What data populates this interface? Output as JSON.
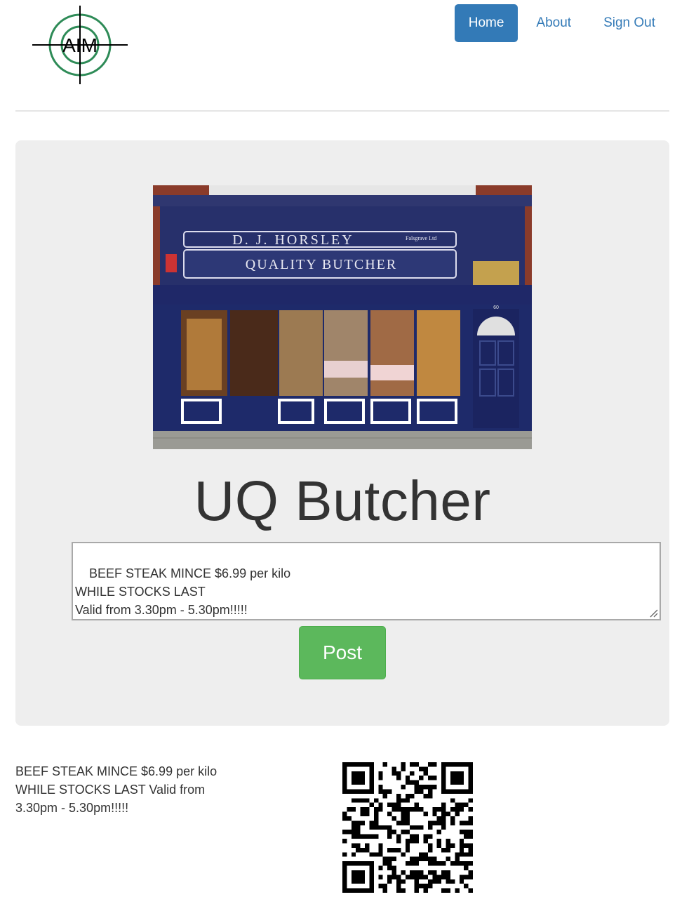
{
  "logo": {
    "text": "AIM",
    "accent": "#2e8b57"
  },
  "nav": {
    "home": "Home",
    "about": "About",
    "sign_out": "Sign Out",
    "active_color": "#337ab7"
  },
  "shop_photo": {
    "sign_name": "D. J. HORSLEY",
    "sign_small": "Falsgrave Ltd",
    "sign_sub": "QUALITY BUTCHER",
    "door_number": "60"
  },
  "jumbotron": {
    "title": "UQ Butcher",
    "textarea_value": "BEEF STEAK MINCE $6.99 per kilo\nWHILE STOCKS LAST\nValid from 3.30pm - 5.30pm!!!!!",
    "post_label": "Post",
    "post_color": "#5cb85c"
  },
  "post": {
    "text": "BEEF STEAK MINCE $6.99 per kilo WHILE STOCKS LAST Valid from 3.30pm - 5.30pm!!!!!"
  },
  "qr": {
    "icon": "qr-code-icon"
  }
}
